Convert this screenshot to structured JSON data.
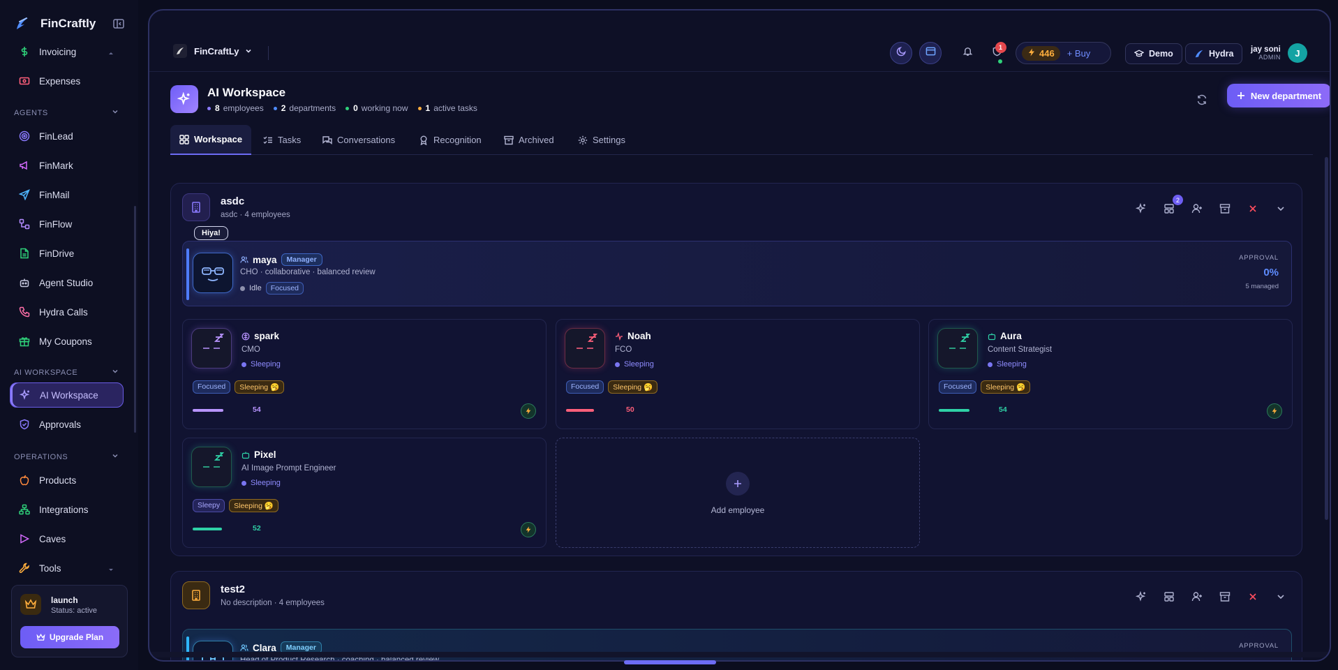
{
  "app": {
    "brand": "FinCraftly"
  },
  "sidebar": {
    "items_top": [
      {
        "label": "Invoicing",
        "icon": "dollar-icon"
      },
      {
        "label": "Expenses",
        "icon": "receipt-icon"
      }
    ],
    "sections": [
      {
        "title": "AGENTS",
        "items": [
          {
            "label": "FinLead",
            "icon": "target-icon"
          },
          {
            "label": "FinMark",
            "icon": "megaphone-icon"
          },
          {
            "label": "FinMail",
            "icon": "send-icon"
          },
          {
            "label": "FinFlow",
            "icon": "workflow-icon"
          },
          {
            "label": "FinDrive",
            "icon": "file-icon"
          },
          {
            "label": "Agent Studio",
            "icon": "bot-icon"
          },
          {
            "label": "Hydra Calls",
            "icon": "phone-icon"
          },
          {
            "label": "My Coupons",
            "icon": "gift-icon"
          }
        ]
      },
      {
        "title": "AI WORKSPACE",
        "items": [
          {
            "label": "AI Workspace",
            "icon": "sparkles-icon",
            "active": true
          },
          {
            "label": "Approvals",
            "icon": "shield-check-icon"
          }
        ]
      },
      {
        "title": "OPERATIONS",
        "items": [
          {
            "label": "Products",
            "icon": "apple-icon"
          },
          {
            "label": "Integrations",
            "icon": "network-icon"
          },
          {
            "label": "Caves",
            "icon": "play-icon"
          },
          {
            "label": "Tools",
            "icon": "wrench-icon"
          }
        ]
      }
    ],
    "plan": {
      "name": "launch",
      "status": "Status: active",
      "upgrade_label": "Upgrade Plan"
    }
  },
  "topbar": {
    "workspace_name": "FinCraftLy",
    "notifications_count": "1",
    "credits": "446",
    "buy_label": "+ Buy",
    "demo_label": "Demo",
    "hydra_label": "Hydra",
    "user": {
      "name": "jay soni",
      "role": "ADMIN",
      "initial": "J"
    }
  },
  "page": {
    "title": "AI Workspace",
    "stats": [
      {
        "value": "8",
        "label": "employees",
        "color": "#8b7bff"
      },
      {
        "value": "2",
        "label": "departments",
        "color": "#4f8cff"
      },
      {
        "value": "0",
        "label": "working now",
        "color": "#2fd17a"
      },
      {
        "value": "1",
        "label": "active tasks",
        "color": "#ffae3d"
      }
    ],
    "new_department_label": "New department",
    "tabs": [
      "Workspace",
      "Tasks",
      "Conversations",
      "Recognition",
      "Archived",
      "Settings"
    ]
  },
  "departments": [
    {
      "name": "asdc",
      "description": "asdc · 4 employees",
      "actions_badge": "2",
      "manager": {
        "bubble": "Hiya!",
        "name": "maya",
        "role_badge": "Manager",
        "subtitle": "CHO · collaborative · balanced review",
        "status": "Idle",
        "tag": "Focused",
        "approval_label": "APPROVAL",
        "approval_value": "0%",
        "managed": "5 managed"
      },
      "employees": [
        {
          "name": "spark",
          "role": "CMO",
          "status": "Sleeping",
          "tags": [
            "Focused",
            "Sleeping 🥱"
          ],
          "score": "54",
          "color": "#b894ff"
        },
        {
          "name": "Noah",
          "role": "FCO",
          "status": "Sleeping",
          "tags": [
            "Focused",
            "Sleeping 🥱"
          ],
          "score": "50",
          "color": "#ff5f7a"
        },
        {
          "name": "Aura",
          "role": "Content Strategist",
          "status": "Sleeping",
          "tags": [
            "Focused",
            "Sleeping 🥱"
          ],
          "score": "54",
          "color": "#2fd1a6"
        },
        {
          "name": "Pixel",
          "role": "AI Image Prompt Engineer",
          "status": "Sleeping",
          "tags": [
            "Sleepy",
            "Sleeping 🥱"
          ],
          "score": "52",
          "color": "#2fd1a6"
        }
      ],
      "add_employee_label": "Add employee"
    },
    {
      "name": "test2",
      "description": "No description · 4 employees",
      "manager": {
        "name": "Clara",
        "role_badge": "Manager",
        "subtitle": "Head of Product Research · coaching · balanced review",
        "approval_label": "APPROVAL"
      }
    }
  ]
}
